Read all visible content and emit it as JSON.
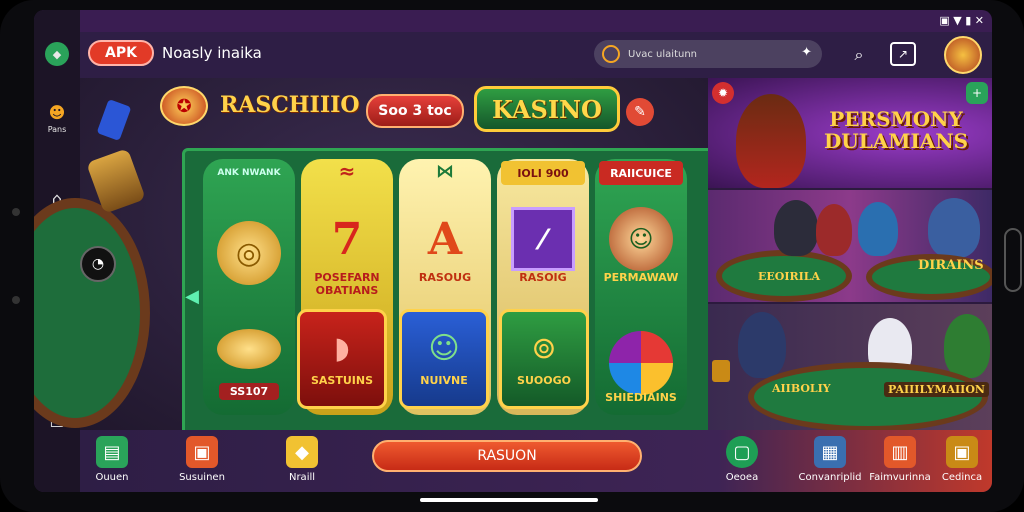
{
  "status": {
    "icons": "▣ ▼ ▮ ✕"
  },
  "system_nav": {
    "label_top": "Pans"
  },
  "topbar": {
    "apk_badge": "APK",
    "title": "Noasly inaika",
    "search_placeholder": "Uvac ulaitunn"
  },
  "game": {
    "logo_text": "RASCHIIIO",
    "header_button": "Soo 3 toc",
    "kasino_logo": "KASINO",
    "reels": [
      {
        "head": "ANK NWANK",
        "symbol_label": "",
        "bottom_label": "SS107"
      },
      {
        "head": "",
        "symbol_label": "POSEFARN OBATIANS",
        "bottom_label": "SASTUINS"
      },
      {
        "head": "",
        "symbol_label": "RASOUG",
        "bottom_label": "NUIVNE"
      },
      {
        "head": "IOLI 900",
        "symbol_label": "RASOIG",
        "bottom_label": "SUOOGO"
      },
      {
        "head": "RAIICUICE",
        "symbol_label": "PERMAWAW",
        "bottom_label": "SHIEDIAINS"
      }
    ]
  },
  "banners": [
    {
      "title": "PERSMONY DULAMIANS"
    },
    {
      "label1": "EEOIRILA",
      "label2": "DIRAINS"
    },
    {
      "label1": "AIIBOLIY",
      "label2": "PAIIILYMAIION"
    }
  ],
  "bottom_nav": {
    "items": [
      {
        "label": "Ouuen"
      },
      {
        "label": "Susuinen"
      },
      {
        "label": "Nraill"
      },
      {
        "label": "Oeoea"
      },
      {
        "label": "Convanriplid"
      },
      {
        "label": "Faimvurinna"
      },
      {
        "label": "Cedinca"
      }
    ],
    "center_button": "RASUON"
  }
}
